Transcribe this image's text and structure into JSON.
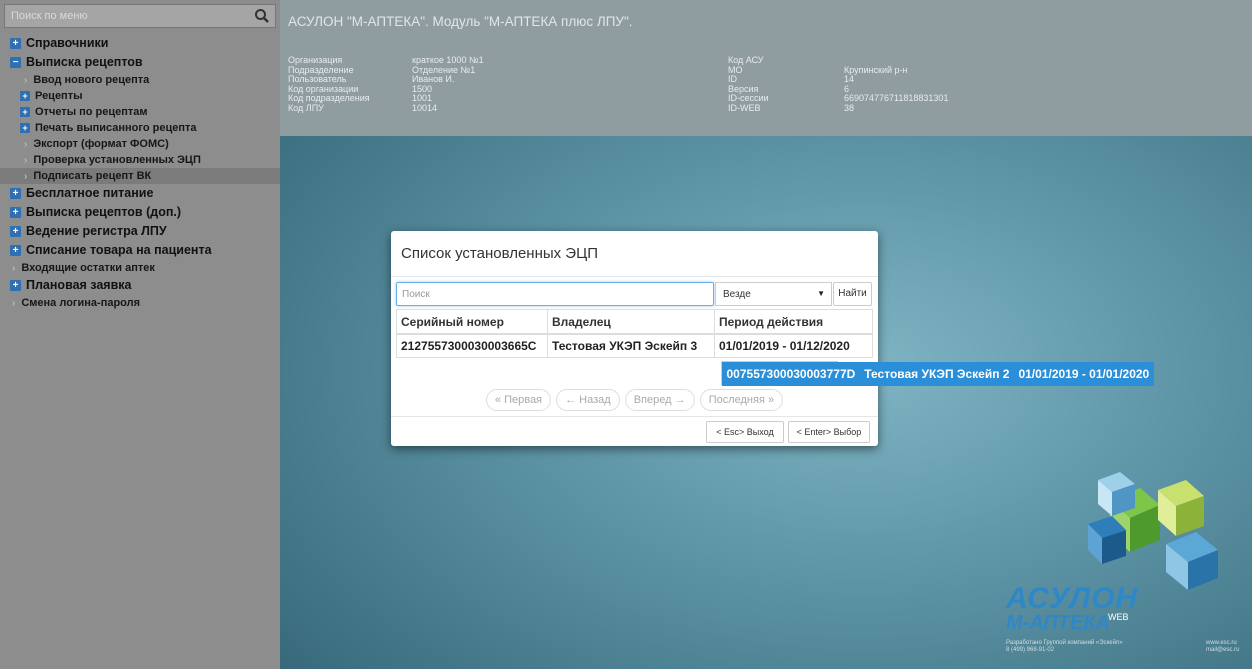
{
  "sidebar": {
    "search_placeholder": "Поиск по меню",
    "items": [
      {
        "label": "Справочники"
      },
      {
        "label": "Выписка рецептов"
      },
      {
        "label": "Ввод нового рецепта"
      },
      {
        "label": "Рецепты"
      },
      {
        "label": "Отчеты по рецептам"
      },
      {
        "label": "Печать выписанного рецепта"
      },
      {
        "label": "Экспорт (формат ФОМС)"
      },
      {
        "label": "Проверка установленных ЭЦП"
      },
      {
        "label": "Подписать рецепт ВК"
      },
      {
        "label": "Бесплатное питание"
      },
      {
        "label": "Выписка рецептов (доп.)"
      },
      {
        "label": "Ведение регистра ЛПУ"
      },
      {
        "label": "Списание товара на пациента"
      },
      {
        "label": "Входящие остатки аптек"
      },
      {
        "label": "Плановая заявка"
      },
      {
        "label": "Смена логина-пароля"
      }
    ]
  },
  "header": {
    "title": "АСУЛОН \"М-АПТЕКА\". Модуль \"М-АПТЕКА плюс ЛПУ\".",
    "left_keys": [
      "Организация",
      "Подразделение",
      "Пользователь",
      "Код организации",
      "Код подразделения",
      "Код ЛПУ"
    ],
    "left_values": [
      "краткое 1000 №1",
      "Отделение №1",
      "Иванов И.",
      "1500",
      "1001",
      "10014"
    ],
    "right_keys": [
      "Код АСУ",
      "МО",
      "ID",
      "Версия",
      "ID-сессии",
      "ID-WEB"
    ],
    "right_values": [
      "",
      "Крупинский р-н",
      "14",
      "6",
      "669074776711818831301",
      "38"
    ]
  },
  "dialog": {
    "title": "Список установленных ЭЦП",
    "search_placeholder": "Поиск",
    "scope": "Везде",
    "find_label": "Найти",
    "columns": [
      "Серийный номер",
      "Владелец",
      "Период действия"
    ],
    "rows": [
      {
        "serial": "007557300030003777D",
        "owner": "Тестовая УКЭП Эскейп 2",
        "period": "01/01/2019 - 01/01/2020"
      },
      {
        "serial": "2127557300030003665C",
        "owner": "Тестовая УКЭП Эскейп 3",
        "period": "01/01/2019 - 01/12/2020"
      }
    ],
    "pager": {
      "first": "« Первая",
      "prev": "← Назад",
      "next": "Вперед →",
      "last": "Последняя »"
    },
    "esc_label": "< Esc> Выход",
    "enter_label": "< Enter> Выбор"
  },
  "logo": {
    "line1": "АСУЛОН",
    "line2": "М-АПТЕКА",
    "web": "WEB",
    "dev": "Разработано Группой компаний «Эскейп»",
    "phone": "8 (499) 968-91-02",
    "site": "www.esc.ru",
    "mail": "mail@esc.ru"
  },
  "colors": {
    "accent": "#2a8fd8",
    "sidebar_icon": "#2f6fb3",
    "logo_blue": "#2e88c8"
  }
}
